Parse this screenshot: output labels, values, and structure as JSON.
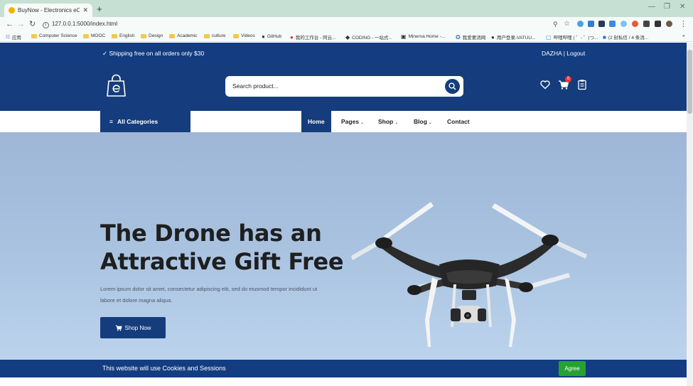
{
  "browser": {
    "tab_title": "BuyNow - Electronics eComm...",
    "url": "127.0.0.1:5000/index.html",
    "bookmarks": [
      "应用",
      "Computer Science",
      "MOOC",
      "English",
      "Design",
      "Academic",
      "culture",
      "Videos",
      "GitHub",
      "我的工作台 - 阿云...",
      "CODING - 一站式...",
      "Minerva Home -...",
      "我爱要消网",
      "用户登录-VATUU...",
      "哔哩哔哩 ( ゜- ゜)つ...",
      "(2 封私信 / 4 条消..."
    ]
  },
  "topbar": {
    "shipping": "✓ Shipping free on all orders only $30",
    "account": "DAZHA | Logout"
  },
  "header": {
    "search_placeholder": "Search product...",
    "cart_count": "0"
  },
  "nav": {
    "all_categories": "All Categories",
    "items": [
      "Home",
      "Pages",
      "Shop",
      "Blog",
      "Contact"
    ],
    "active": "Home"
  },
  "hero": {
    "title_line1": "The Drone has an",
    "title_line2": "Attractive Gift Free",
    "text": "Lorem ipsum dolor sit amet, consectetur adipiscing elit, sed do eiusmod tempor incididunt ut labore et dolore magna aliqua.",
    "button": "Shop Now"
  },
  "cookie": {
    "text": "This website will use Cookies and Sessions",
    "button": "Agree"
  },
  "colors": {
    "brand": "#153d7d",
    "agree": "#26a232",
    "badge": "#e53935"
  }
}
